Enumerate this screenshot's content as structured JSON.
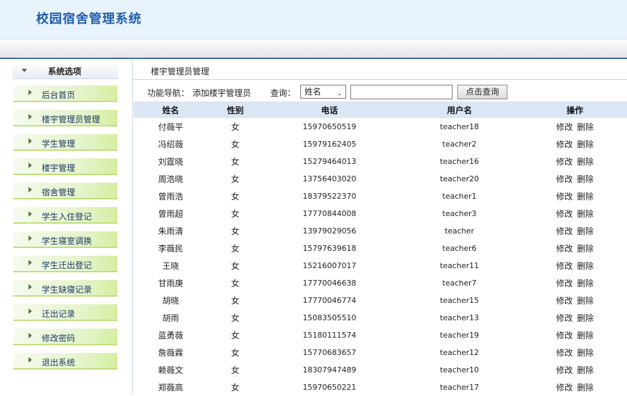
{
  "app": {
    "title": "校园宿舍管理系统"
  },
  "sidebar": {
    "header": "系统选项",
    "items": [
      {
        "label": "后台首页"
      },
      {
        "label": "楼宇管理员管理"
      },
      {
        "label": "学生管理"
      },
      {
        "label": "楼宇管理"
      },
      {
        "label": "宿舍管理"
      },
      {
        "label": "学生入住登记"
      },
      {
        "label": "学生寝室调换"
      },
      {
        "label": "学生迁出登记"
      },
      {
        "label": "学生缺寝记录"
      },
      {
        "label": "迁出记录"
      },
      {
        "label": "修改密码"
      },
      {
        "label": "退出系统"
      }
    ]
  },
  "main": {
    "breadcrumb": "楼宇管理员管理",
    "toolbar": {
      "nav_label": "功能导航：",
      "add_link": "添加楼宇管理员",
      "query_label": "查询：",
      "select_value": "姓名",
      "search_value": "",
      "search_button": "点击查询"
    },
    "table": {
      "headers": [
        "姓名",
        "性别",
        "电话",
        "用户名",
        "操作"
      ],
      "edit_label": "修改",
      "delete_label": "删除",
      "rows": [
        {
          "name": "付薇平",
          "gender": "女",
          "phone": "15970650519",
          "username": "teacher18"
        },
        {
          "name": "冯绍薇",
          "gender": "女",
          "phone": "15979162405",
          "username": "teacher2"
        },
        {
          "name": "刘霆晓",
          "gender": "女",
          "phone": "15279464013",
          "username": "teacher16"
        },
        {
          "name": "周浩晓",
          "gender": "女",
          "phone": "13756403020",
          "username": "teacher20"
        },
        {
          "name": "曾雨浩",
          "gender": "女",
          "phone": "18379522370",
          "username": "teacher1"
        },
        {
          "name": "曾雨超",
          "gender": "女",
          "phone": "17770844008",
          "username": "teacher3"
        },
        {
          "name": "朱雨清",
          "gender": "女",
          "phone": "13979029056",
          "username": "teacher"
        },
        {
          "name": "李薇民",
          "gender": "女",
          "phone": "15797639618",
          "username": "teacher6"
        },
        {
          "name": "王晓",
          "gender": "女",
          "phone": "15216007017",
          "username": "teacher11"
        },
        {
          "name": "甘雨庚",
          "gender": "女",
          "phone": "17770046638",
          "username": "teacher7"
        },
        {
          "name": "胡晓",
          "gender": "女",
          "phone": "17770046774",
          "username": "teacher15"
        },
        {
          "name": "胡雨",
          "gender": "女",
          "phone": "15083505510",
          "username": "teacher13"
        },
        {
          "name": "蓝勇薇",
          "gender": "女",
          "phone": "15180111574",
          "username": "teacher19"
        },
        {
          "name": "詹薇霖",
          "gender": "女",
          "phone": "15770683657",
          "username": "teacher12"
        },
        {
          "name": "赖薇文",
          "gender": "女",
          "phone": "18307947489",
          "username": "teacher10"
        },
        {
          "name": "郑薇高",
          "gender": "女",
          "phone": "15970650221",
          "username": "teacher17"
        }
      ]
    }
  }
}
